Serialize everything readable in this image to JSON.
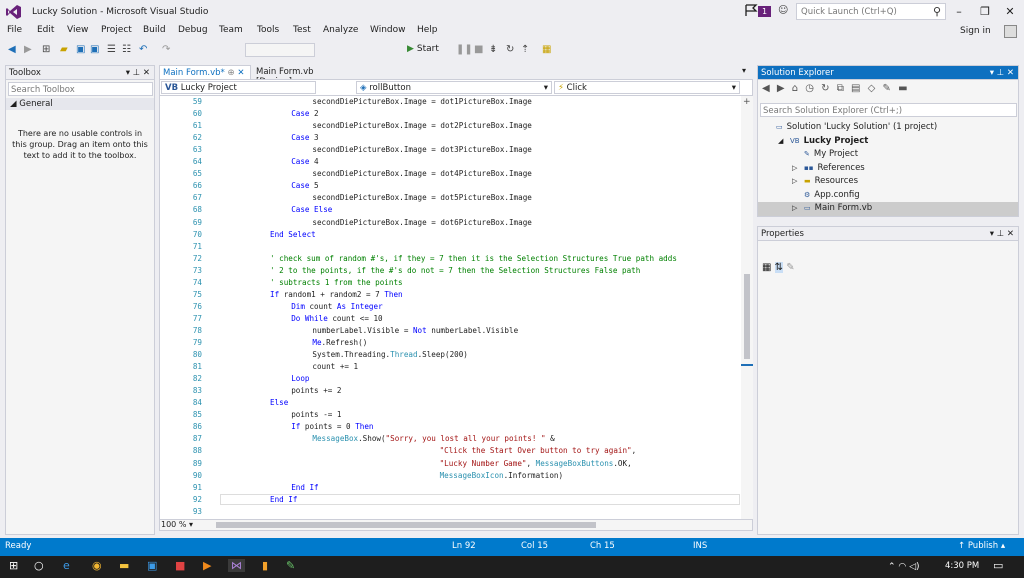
{
  "window": {
    "title": "Lucky Solution - Microsoft Visual Studio",
    "notification_count": "1",
    "quick_launch_placeholder": "Quick Launch (Ctrl+Q)",
    "minimize": "–",
    "restore": "❐",
    "close": "✕"
  },
  "menu": {
    "items": [
      "File",
      "Edit",
      "View",
      "Project",
      "Build",
      "Debug",
      "Team",
      "Tools",
      "Test",
      "Analyze",
      "Window",
      "Help"
    ],
    "sign_in": "Sign in"
  },
  "toolbar": {
    "start_label": "Start"
  },
  "toolbox": {
    "title": "Toolbox",
    "search_placeholder": "Search Toolbox",
    "group": "General",
    "empty_message": "There are no usable controls in this group. Drag an item onto this text to add it to the toolbox."
  },
  "tabs": [
    {
      "label": "Main Form.vb*",
      "active": true
    },
    {
      "label": "Main Form.vb [Design]",
      "active": false
    }
  ],
  "navbar": {
    "project": "Lucky Project",
    "object": "rollButton",
    "event": "Click"
  },
  "editor": {
    "zoom": "100 %",
    "lines": [
      {
        "n": "59",
        "indent": 3,
        "segments": [
          {
            "t": "secondDiePictureBox.Image = dot1PictureBox.Image",
            "c": "fn"
          }
        ]
      },
      {
        "n": "60",
        "indent": 2,
        "segments": [
          {
            "t": "Case",
            "c": "kw"
          },
          {
            "t": " 2",
            "c": "fn"
          }
        ]
      },
      {
        "n": "61",
        "indent": 3,
        "segments": [
          {
            "t": "secondDiePictureBox.Image = dot2PictureBox.Image",
            "c": "fn"
          }
        ]
      },
      {
        "n": "62",
        "indent": 2,
        "segments": [
          {
            "t": "Case",
            "c": "kw"
          },
          {
            "t": " 3",
            "c": "fn"
          }
        ]
      },
      {
        "n": "63",
        "indent": 3,
        "segments": [
          {
            "t": "secondDiePictureBox.Image = dot3PictureBox.Image",
            "c": "fn"
          }
        ]
      },
      {
        "n": "64",
        "indent": 2,
        "segments": [
          {
            "t": "Case",
            "c": "kw"
          },
          {
            "t": " 4",
            "c": "fn"
          }
        ]
      },
      {
        "n": "65",
        "indent": 3,
        "segments": [
          {
            "t": "secondDiePictureBox.Image = dot4PictureBox.Image",
            "c": "fn"
          }
        ]
      },
      {
        "n": "66",
        "indent": 2,
        "segments": [
          {
            "t": "Case",
            "c": "kw"
          },
          {
            "t": " 5",
            "c": "fn"
          }
        ]
      },
      {
        "n": "67",
        "indent": 3,
        "segments": [
          {
            "t": "secondDiePictureBox.Image = dot5PictureBox.Image",
            "c": "fn"
          }
        ]
      },
      {
        "n": "68",
        "indent": 2,
        "segments": [
          {
            "t": "Case Else",
            "c": "kw"
          }
        ]
      },
      {
        "n": "69",
        "indent": 3,
        "segments": [
          {
            "t": "secondDiePictureBox.Image = dot6PictureBox.Image",
            "c": "fn"
          }
        ]
      },
      {
        "n": "70",
        "indent": 1,
        "segments": [
          {
            "t": "End Select",
            "c": "kw"
          }
        ]
      },
      {
        "n": "71",
        "indent": 0,
        "segments": []
      },
      {
        "n": "72",
        "indent": 1,
        "segments": [
          {
            "t": "' check sum of random #'s, if they = 7 then it is the Selection Structures True path adds",
            "c": "cm"
          }
        ]
      },
      {
        "n": "73",
        "indent": 1,
        "segments": [
          {
            "t": "' 2 to the points, if the #'s do not = 7 then the Selection Structures False path",
            "c": "cm"
          }
        ]
      },
      {
        "n": "74",
        "indent": 1,
        "segments": [
          {
            "t": "' subtracts 1 from the points",
            "c": "cm"
          }
        ]
      },
      {
        "n": "75",
        "indent": 1,
        "segments": [
          {
            "t": "If",
            "c": "kw"
          },
          {
            "t": " random1 + random2 = 7 ",
            "c": "fn"
          },
          {
            "t": "Then",
            "c": "kw"
          }
        ]
      },
      {
        "n": "76",
        "indent": 2,
        "segments": [
          {
            "t": "Dim",
            "c": "kw"
          },
          {
            "t": " count ",
            "c": "fn"
          },
          {
            "t": "As Integer",
            "c": "kw"
          }
        ]
      },
      {
        "n": "77",
        "indent": 2,
        "segments": [
          {
            "t": "Do While",
            "c": "kw"
          },
          {
            "t": " count <= 10",
            "c": "fn"
          }
        ]
      },
      {
        "n": "78",
        "indent": 3,
        "segments": [
          {
            "t": "numberLabel.Visible = ",
            "c": "fn"
          },
          {
            "t": "Not",
            "c": "kw"
          },
          {
            "t": " numberLabel.Visible",
            "c": "fn"
          }
        ]
      },
      {
        "n": "79",
        "indent": 3,
        "segments": [
          {
            "t": "Me",
            "c": "kw"
          },
          {
            "t": ".Refresh()",
            "c": "fn"
          }
        ]
      },
      {
        "n": "80",
        "indent": 3,
        "segments": [
          {
            "t": "System.Threading.",
            "c": "fn"
          },
          {
            "t": "Thread",
            "c": "ty"
          },
          {
            "t": ".Sleep(200)",
            "c": "fn"
          }
        ]
      },
      {
        "n": "81",
        "indent": 3,
        "segments": [
          {
            "t": "count += 1",
            "c": "fn"
          }
        ]
      },
      {
        "n": "82",
        "indent": 2,
        "segments": [
          {
            "t": "Loop",
            "c": "kw"
          }
        ]
      },
      {
        "n": "83",
        "indent": 2,
        "segments": [
          {
            "t": "points += 2",
            "c": "fn"
          }
        ]
      },
      {
        "n": "84",
        "indent": 1,
        "segments": [
          {
            "t": "Else",
            "c": "kw"
          }
        ]
      },
      {
        "n": "85",
        "indent": 2,
        "segments": [
          {
            "t": "points -= 1",
            "c": "fn"
          }
        ]
      },
      {
        "n": "86",
        "indent": 2,
        "segments": [
          {
            "t": "If",
            "c": "kw"
          },
          {
            "t": " points = 0 ",
            "c": "fn"
          },
          {
            "t": "Then",
            "c": "kw"
          }
        ]
      },
      {
        "n": "87",
        "indent": 3,
        "segments": [
          {
            "t": "MessageBox",
            "c": "ty"
          },
          {
            "t": ".Show(",
            "c": "fn"
          },
          {
            "t": "\"Sorry, you lost all your points! \"",
            "c": "st"
          },
          {
            "t": " &",
            "c": "fn"
          }
        ]
      },
      {
        "n": "88",
        "indent": 9,
        "segments": [
          {
            "t": "\"Click the Start Over button to try again\"",
            "c": "st"
          },
          {
            "t": ",",
            "c": "fn"
          }
        ]
      },
      {
        "n": "89",
        "indent": 9,
        "segments": [
          {
            "t": "\"Lucky Number Game\"",
            "c": "st"
          },
          {
            "t": ", ",
            "c": "fn"
          },
          {
            "t": "MessageBoxButtons",
            "c": "ty"
          },
          {
            "t": ".OK,",
            "c": "fn"
          }
        ]
      },
      {
        "n": "90",
        "indent": 9,
        "segments": [
          {
            "t": "MessageBoxIcon",
            "c": "ty"
          },
          {
            "t": ".Information)",
            "c": "fn"
          }
        ]
      },
      {
        "n": "91",
        "indent": 2,
        "segments": [
          {
            "t": "End If",
            "c": "kw"
          }
        ]
      },
      {
        "n": "92",
        "indent": 1,
        "segments": [
          {
            "t": "End If",
            "c": "kw"
          }
        ]
      },
      {
        "n": "93",
        "indent": 0,
        "segments": []
      }
    ]
  },
  "solution_explorer": {
    "title": "Solution Explorer",
    "search_placeholder": "Search Solution Explorer (Ctrl+;)",
    "tree": [
      {
        "label": "Solution 'Lucky Solution' (1 project)",
        "depth": 0,
        "icon": "solution-icon",
        "expander": ""
      },
      {
        "label": "Lucky Project",
        "depth": 1,
        "icon": "vb-project-icon",
        "expander": "◢",
        "bold": true
      },
      {
        "label": "My Project",
        "depth": 2,
        "icon": "wrench-icon",
        "expander": ""
      },
      {
        "label": "References",
        "depth": 2,
        "icon": "references-icon",
        "expander": "▷"
      },
      {
        "label": "Resources",
        "depth": 2,
        "icon": "folder-icon",
        "expander": "▷"
      },
      {
        "label": "App.config",
        "depth": 2,
        "icon": "config-icon",
        "expander": ""
      },
      {
        "label": "Main Form.vb",
        "depth": 2,
        "icon": "form-icon",
        "expander": "▷",
        "selected": true
      }
    ]
  },
  "properties": {
    "title": "Properties"
  },
  "status": {
    "ready": "Ready",
    "line": "Ln 92",
    "col": "Col 15",
    "ch": "Ch 15",
    "mode": "INS",
    "publish": "Publish"
  },
  "taskbar": {
    "time": "4:30 PM"
  },
  "colors": {
    "accent": "#007acc",
    "vs_purple": "#68217a",
    "keyword": "#0000ff",
    "comment": "#008000",
    "string": "#a31515",
    "type": "#2b91af"
  }
}
